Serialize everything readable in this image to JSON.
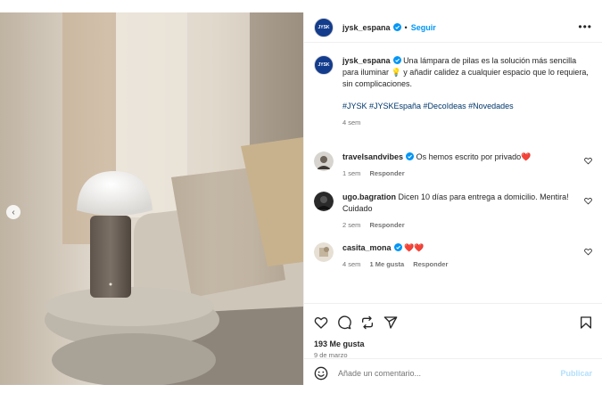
{
  "post": {
    "username": "jysk_espana",
    "avatar_text": "JYSK",
    "follow_label": "Seguir",
    "separator": "•",
    "more_icon": "more-horizontal-icon",
    "caption": "Una lámpara de pilas es la solución más sencilla para iluminar 💡 y añadir calidez a cualquier espacio que lo requiera, sin complicaciones.",
    "hashtags": "#JYSK #JYSKEspaña #DecoIdeas #Novedades",
    "caption_time": "4 sem",
    "likes": "193 Me gusta",
    "date": "9 de marzo"
  },
  "comments": [
    {
      "username": "travelsandvibes",
      "verified": true,
      "text": "Os hemos escrito por privado❤️",
      "time": "1 sem",
      "likes": "",
      "reply": "Responder"
    },
    {
      "username": "ugo.bagration",
      "verified": false,
      "text": "Dicen 10 días para entrega a domicilio. Mentira! Cuidado",
      "time": "2 sem",
      "likes": "",
      "reply": "Responder"
    },
    {
      "username": "casita_mona",
      "verified": true,
      "text": "❤️❤️",
      "time": "4 sem",
      "likes": "1 Me gusta",
      "reply": "Responder"
    }
  ],
  "composer": {
    "placeholder": "Añade un comentario...",
    "publish_label": "Publicar",
    "emoji_icon": "emoji-icon"
  },
  "carousel": {
    "prev_glyph": "‹",
    "slide_count": 2,
    "active_slide": 2
  },
  "colors": {
    "link": "#0095f6",
    "hashtag": "#00376b",
    "verified": "#0095f6",
    "brand": "#143c8c"
  }
}
